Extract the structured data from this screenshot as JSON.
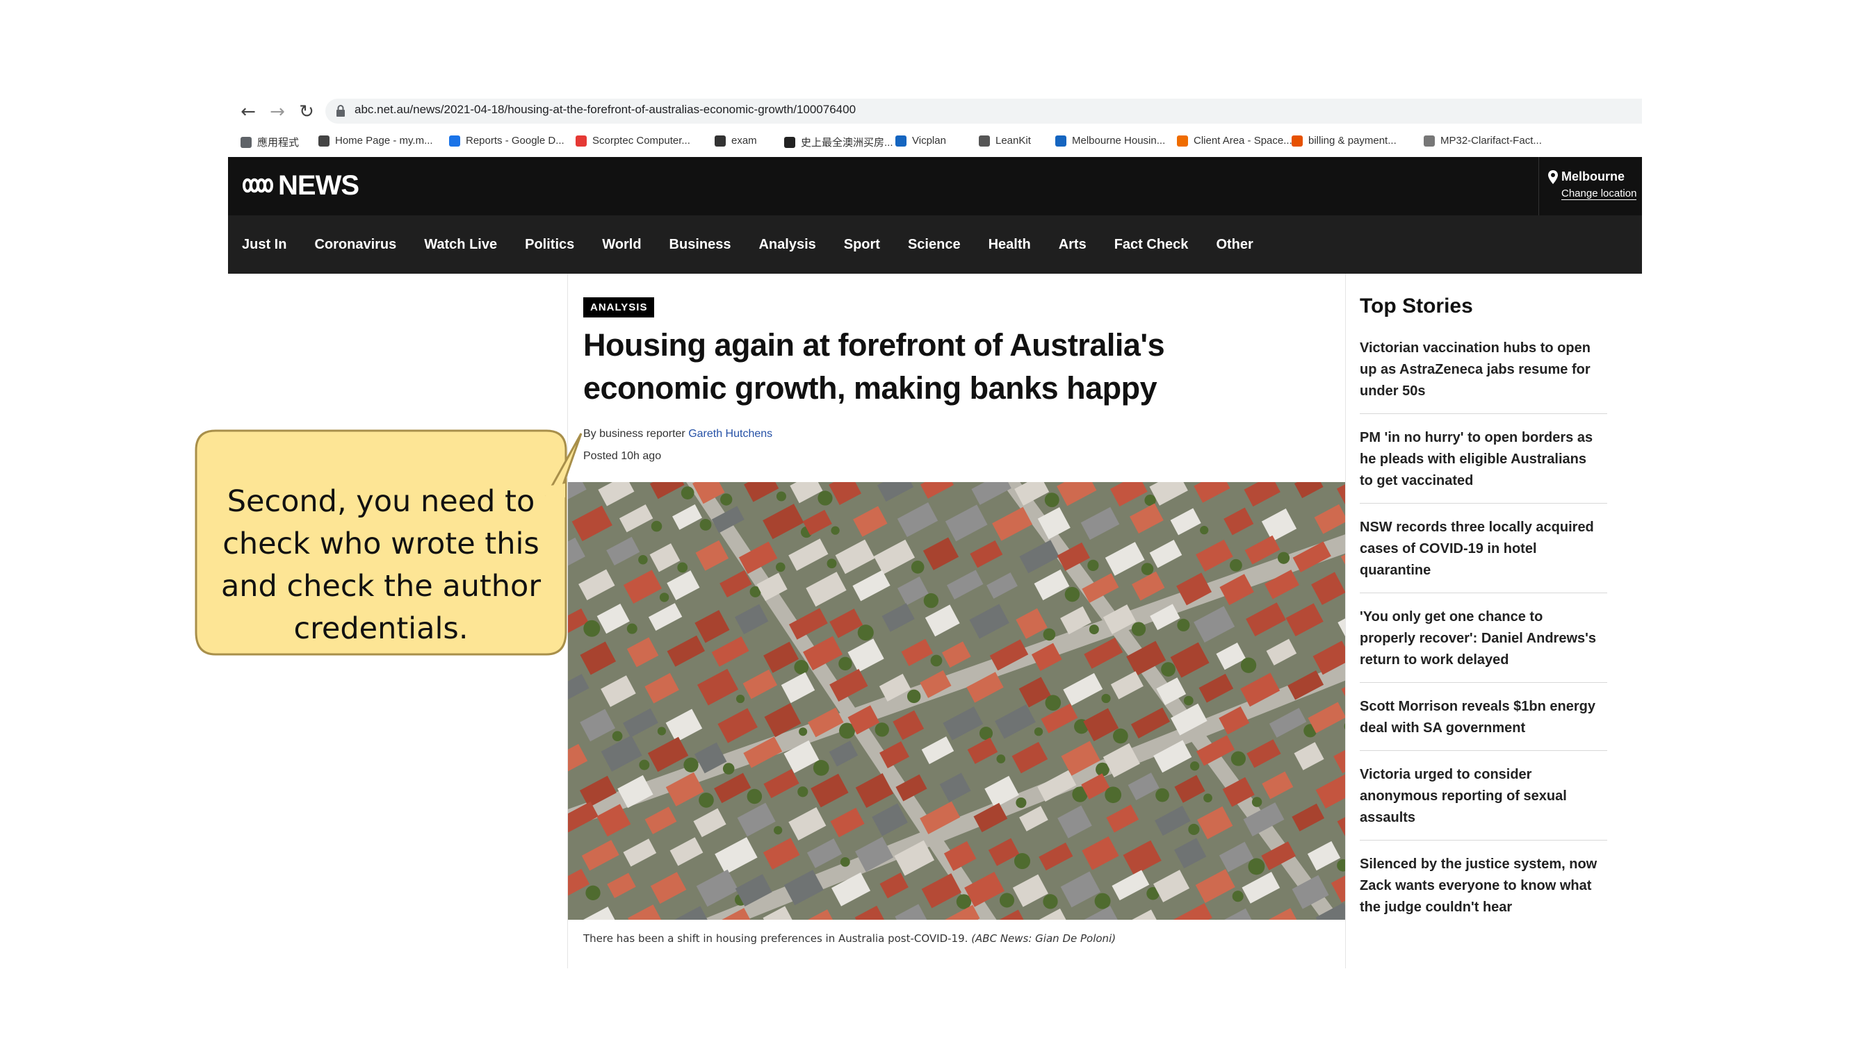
{
  "browser": {
    "url": "abc.net.au/news/2021-04-18/housing-at-the-forefront-of-australias-economic-growth/100076400",
    "bookmarks": [
      {
        "label": "應用程式",
        "color": "#5f6368"
      },
      {
        "label": "Home Page - my.m...",
        "color": "#444444"
      },
      {
        "label": "Reports - Google D...",
        "color": "#1a73e8"
      },
      {
        "label": "Scorptec Computer...",
        "color": "#e53935"
      },
      {
        "label": "exam",
        "color": "#333333"
      },
      {
        "label": "史上最全澳洲买房...",
        "color": "#222222"
      },
      {
        "label": "Vicplan",
        "color": "#1565c0"
      },
      {
        "label": "LeanKit",
        "color": "#555555"
      },
      {
        "label": "Melbourne Housin...",
        "color": "#1565c0"
      },
      {
        "label": "Client Area - Space...",
        "color": "#ef6c00"
      },
      {
        "label": "billing & payment...",
        "color": "#e65100"
      },
      {
        "label": "MP32-Clarifact-Fact...",
        "color": "#777777"
      }
    ]
  },
  "header": {
    "logo_text": "NEWS",
    "location_city": "Melbourne",
    "location_change": "Change location"
  },
  "nav": {
    "items": [
      "Just In",
      "Coronavirus",
      "Watch Live",
      "Politics",
      "World",
      "Business",
      "Analysis",
      "Sport",
      "Science",
      "Health",
      "Arts",
      "Fact Check",
      "Other"
    ]
  },
  "article": {
    "badge": "ANALYSIS",
    "headline_line1": "Housing again at forefront of Australia's",
    "headline_line2": "economic growth, making banks happy",
    "byline_prefix": "By business reporter ",
    "author": "Gareth Hutchens",
    "posted": "Posted 10h ago",
    "caption": "There has been a shift in housing preferences in Australia post-COVID-19. ",
    "credit": "(ABC News: Gian De Poloni)"
  },
  "sidebar": {
    "title": "Top Stories",
    "stories": [
      [
        "Victorian vaccination hubs to open",
        "up as AstraZeneca jabs resume for",
        "under 50s"
      ],
      [
        "PM 'in no hurry' to open borders as",
        "he pleads with eligible Australians",
        "to get vaccinated"
      ],
      [
        "NSW records three locally acquired",
        "cases of COVID-19 in hotel",
        "quarantine"
      ],
      [
        "'You only get one chance to",
        "properly recover': Daniel Andrews's",
        "return to work delayed"
      ],
      [
        "Scott Morrison reveals $1bn energy",
        "deal with SA government"
      ],
      [
        "Victoria urged to consider",
        "anonymous reporting of sexual",
        "assaults"
      ],
      [
        "Silenced by the justice system, now",
        "Zack wants everyone to know what",
        "the judge couldn't hear"
      ]
    ]
  },
  "callout": {
    "lines": [
      "Second, you need to",
      "check who wrote this",
      "and check the author",
      "credentials."
    ],
    "fill": "#fde595",
    "stroke": "#a88f4a"
  }
}
